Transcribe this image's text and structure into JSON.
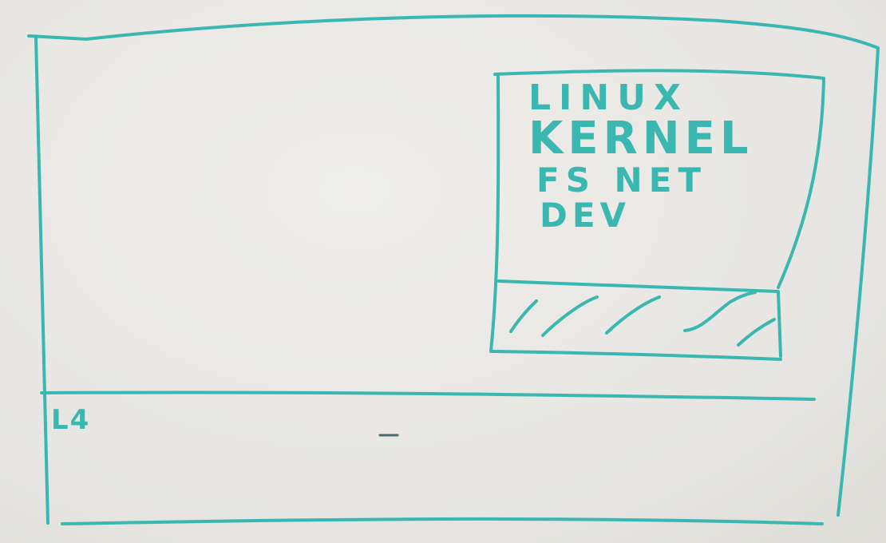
{
  "diagram": {
    "ink_color": "#3ab7b0",
    "board_color": "#e9e8e4",
    "box_title_lines": [
      "LINUX",
      "KERNEL",
      "FS NET",
      "DEV"
    ],
    "bottom_strip_label": "L4"
  }
}
